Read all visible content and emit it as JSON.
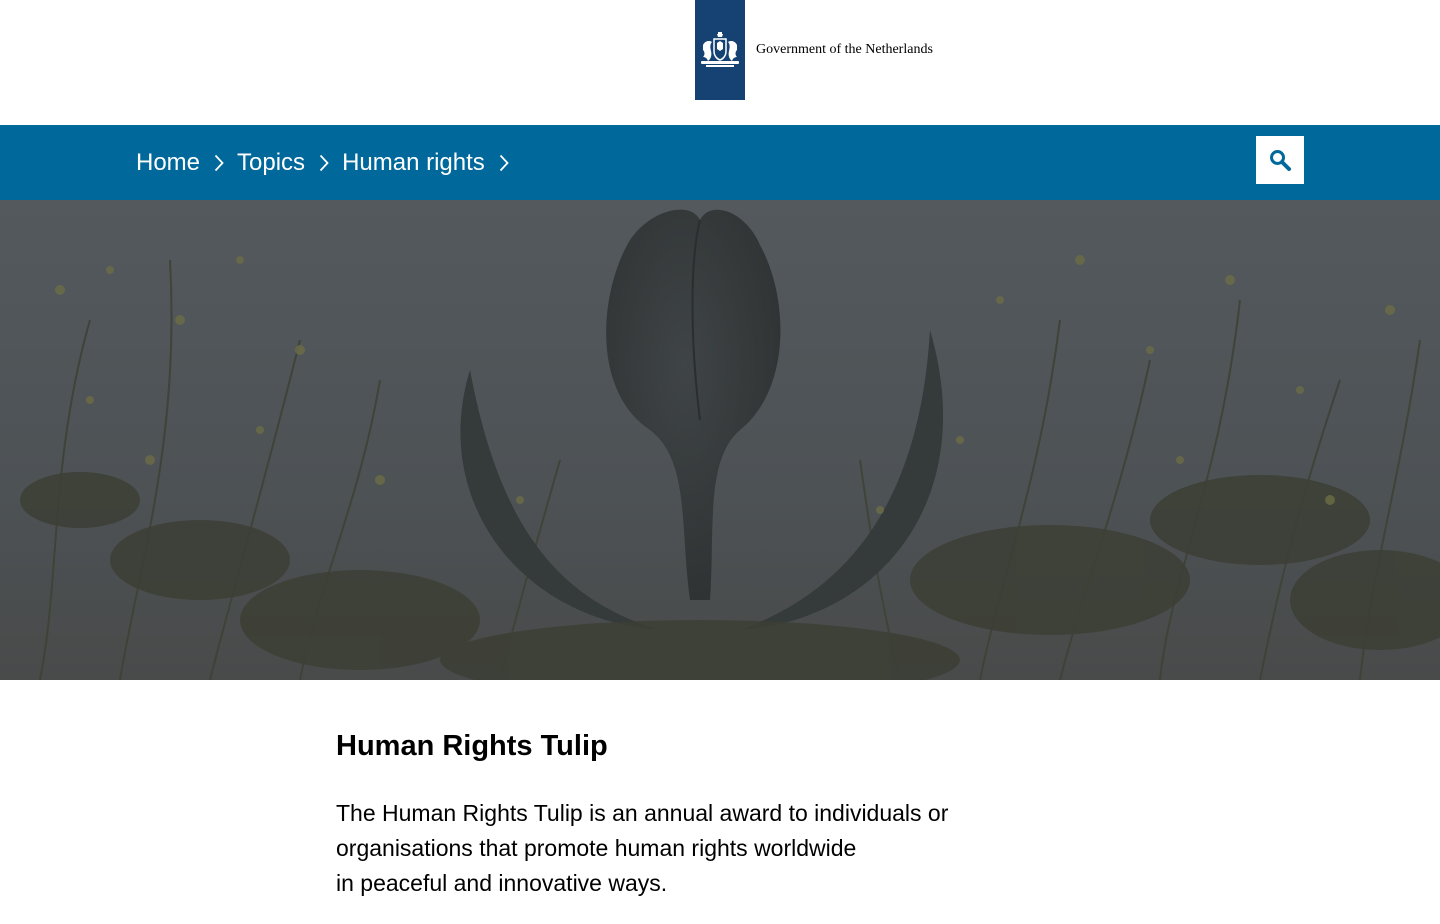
{
  "header": {
    "logo_text": "Government of the Netherlands",
    "ribbon_color": "#154273"
  },
  "nav": {
    "background_color": "#01689b",
    "breadcrumb": [
      {
        "label": "Home"
      },
      {
        "label": "Topics"
      },
      {
        "label": "Human rights"
      }
    ],
    "search_icon": "search-icon"
  },
  "hero": {
    "image": "tulip-sculpture-among-wildflowers"
  },
  "article": {
    "title": "Human Rights Tulip",
    "intro_lines": [
      "The Human Rights Tulip is an annual award to individuals or",
      "organisations that promote human rights worldwide",
      "in peaceful and innovative ways."
    ]
  }
}
